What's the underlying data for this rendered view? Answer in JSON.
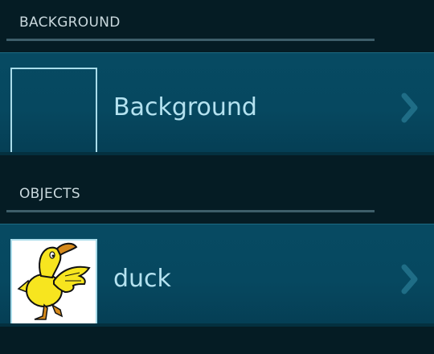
{
  "sections": {
    "background": {
      "title": "BACKGROUND",
      "item": {
        "label": "Background",
        "thumbnail": "empty"
      }
    },
    "objects": {
      "title": "OBJECTS",
      "item": {
        "label": "duck",
        "thumbnail": "duck-image"
      }
    }
  },
  "colors": {
    "page_bg": "#051c24",
    "row_bg": "#064860",
    "label_text": "#b4e2f0",
    "header_text": "#c9d8dd",
    "thumb_border": "#a9dcea"
  },
  "icons": {
    "row_arrow": "chevron-right-icon"
  }
}
